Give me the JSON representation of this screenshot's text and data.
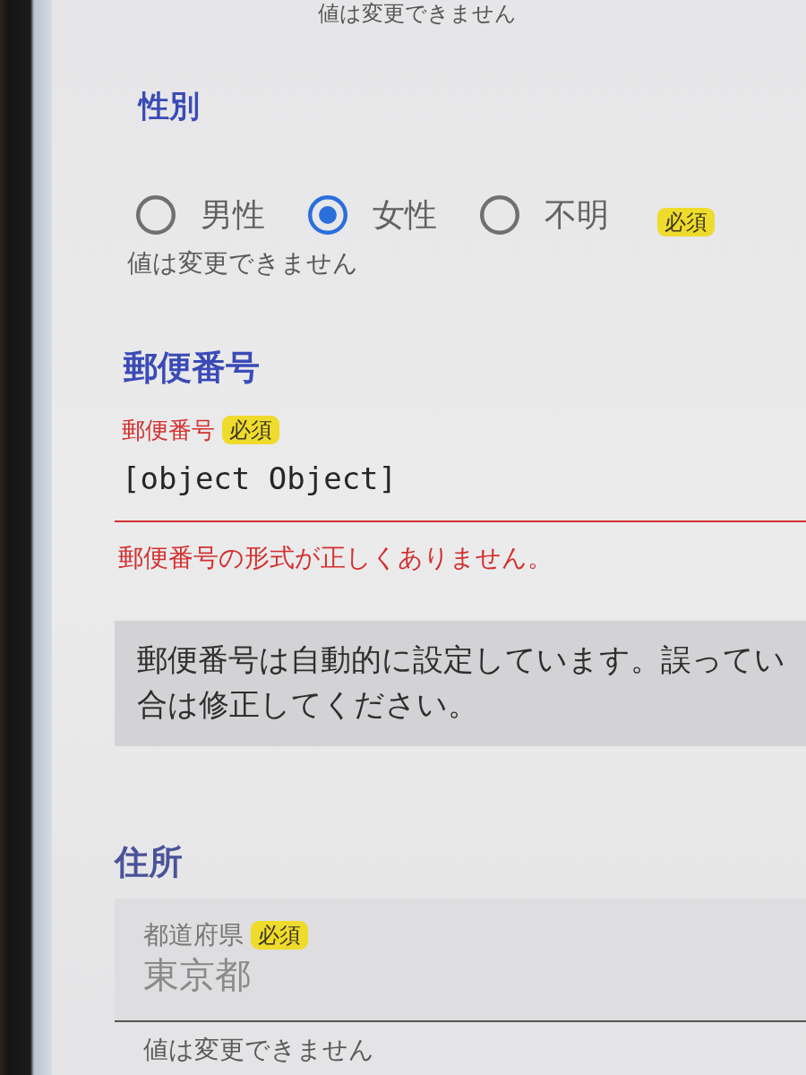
{
  "top_hint": "値は変更できません",
  "gender": {
    "title": "性別",
    "options": [
      {
        "label": "男性",
        "selected": false
      },
      {
        "label": "女性",
        "selected": true
      },
      {
        "label": "不明",
        "selected": false
      }
    ],
    "required_badge": "必須",
    "hint": "値は変更できません"
  },
  "postal_code": {
    "title": "郵便番号",
    "field": {
      "label": "郵便番号",
      "required_badge": "必須",
      "value": "[object Object]",
      "error": true,
      "error_message": "郵便番号の形式が正しくありません。"
    },
    "info": {
      "lines": [
        "郵便番号は自動的に設定しています。誤ってい",
        "合は修正してください。"
      ]
    }
  },
  "address": {
    "title": "住所",
    "prefecture": {
      "label": "都道府県",
      "required_badge": "必須",
      "value": "東京都",
      "disabled": true,
      "hint": "値は変更できません"
    }
  }
}
